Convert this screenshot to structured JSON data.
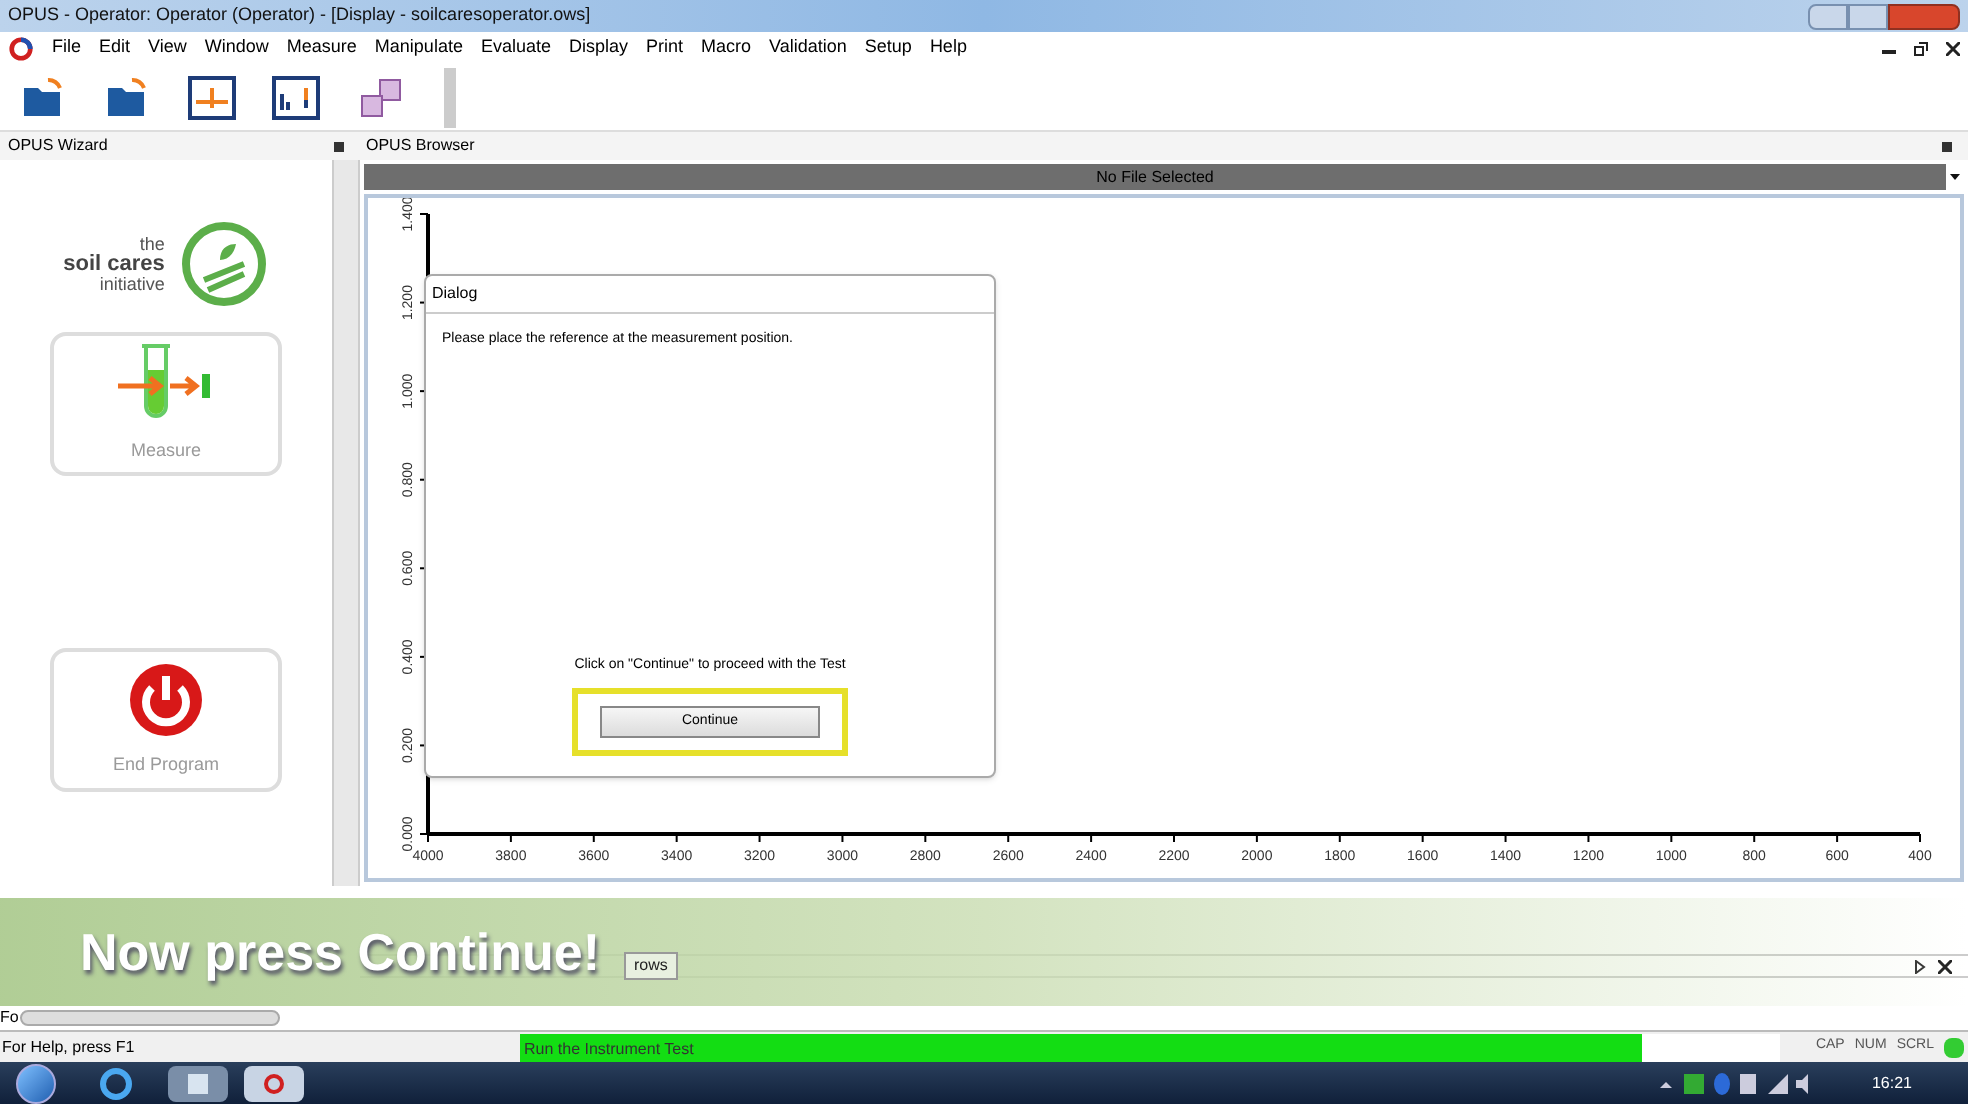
{
  "window": {
    "title": "OPUS - Operator: Operator  (Operator) - [Display - soilcaresoperator.ows]"
  },
  "menu": [
    "File",
    "Edit",
    "View",
    "Window",
    "Measure",
    "Manipulate",
    "Evaluate",
    "Display",
    "Print",
    "Macro",
    "Validation",
    "Setup",
    "Help"
  ],
  "wizard": {
    "title": "OPUS Wizard",
    "logo": {
      "line_1": "the",
      "line_2": "soil cares",
      "line_3": "initiative"
    },
    "buttons": [
      {
        "kind": "measure",
        "label": "Measure"
      },
      {
        "kind": "end",
        "label": "End Program"
      }
    ]
  },
  "browser": {
    "title": "OPUS Browser",
    "file_bar": "No File Selected"
  },
  "chart_data": {
    "type": "line",
    "xlim": [
      4000,
      400
    ],
    "ylim": [
      0,
      1.4
    ],
    "xticks": [
      4000,
      3800,
      3600,
      3400,
      3200,
      3000,
      2800,
      2600,
      2400,
      2200,
      2000,
      1800,
      1600,
      1400,
      1200,
      1000,
      800,
      600,
      400
    ],
    "yticks": [
      {
        "value": 0,
        "label": "0.000"
      },
      {
        "value": 0.2,
        "label": "0.200"
      },
      {
        "value": 0.4,
        "label": "0.400"
      },
      {
        "value": 0.6,
        "label": "0.600"
      },
      {
        "value": 0.8,
        "label": "0.800"
      },
      {
        "value": 1.0,
        "label": "1.000"
      },
      {
        "value": 1.2,
        "label": "1.200"
      },
      {
        "value": 1.4,
        "label": "1.400"
      }
    ]
  },
  "dialog": {
    "title": "Dialog",
    "message": "Please place the reference at the measurement position.",
    "prompt": "Click on \"Continue\" to proceed with the  Test",
    "button": "Continue"
  },
  "bottom_tab": {
    "label": "rows"
  },
  "caption": "Now press Continue!",
  "scroll_label": "Fo",
  "status_bar": {
    "help": "For Help, press F1",
    "task": "Run the Instrument Test",
    "level": 0.89,
    "indicators": [
      "CAP",
      "NUM",
      "SCRL"
    ]
  },
  "taskbar": {
    "time": "16:21"
  }
}
